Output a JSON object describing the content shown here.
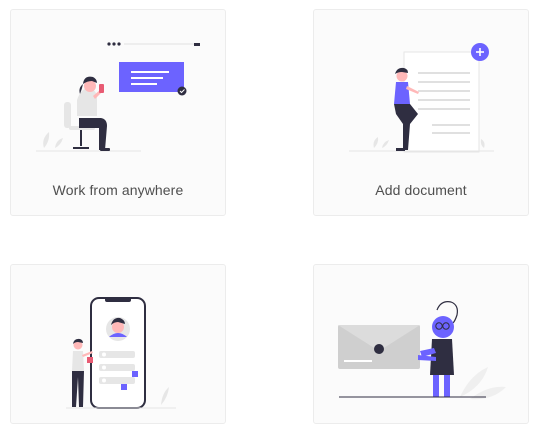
{
  "cards": [
    {
      "label": "Work from anywhere",
      "illustration": "woman-on-chair-with-phone"
    },
    {
      "label": "Add document",
      "illustration": "woman-with-document"
    },
    {
      "label": "",
      "illustration": "woman-with-phone-profile"
    },
    {
      "label": "",
      "illustration": "person-with-envelope"
    }
  ],
  "colors": {
    "accent": "#6c63ff",
    "dark": "#2f2e41",
    "skin": "#ffb8b8",
    "gray": "#e6e6e6",
    "red": "#e85b73",
    "text": "#4f4f4f"
  }
}
